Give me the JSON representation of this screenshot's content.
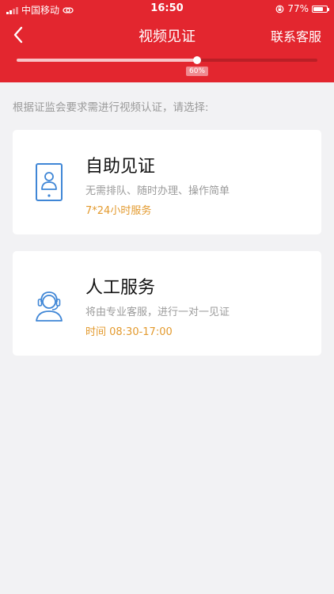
{
  "status_bar": {
    "carrier": "中国移动",
    "time": "16:50",
    "battery": "77%",
    "battery_level": 0.77
  },
  "navbar": {
    "title": "视频见证",
    "right_action": "联系客服"
  },
  "progress": {
    "value": 0.6,
    "label": "60%"
  },
  "hint": "根据证监会要求需进行视频认证，请选择:",
  "options": [
    {
      "title": "自助见证",
      "desc": "无需排队、随时办理、操作简单",
      "extra": "7*24小时服务",
      "icon": "phone-portrait-icon"
    },
    {
      "title": "人工服务",
      "desc": "将由专业客服，进行一对一见证",
      "extra": "时间 08:30-17:00",
      "icon": "headset-agent-icon"
    }
  ],
  "colors": {
    "header": "#e3262f",
    "icon": "#3f86d6",
    "accent_text": "#e39a2e"
  }
}
